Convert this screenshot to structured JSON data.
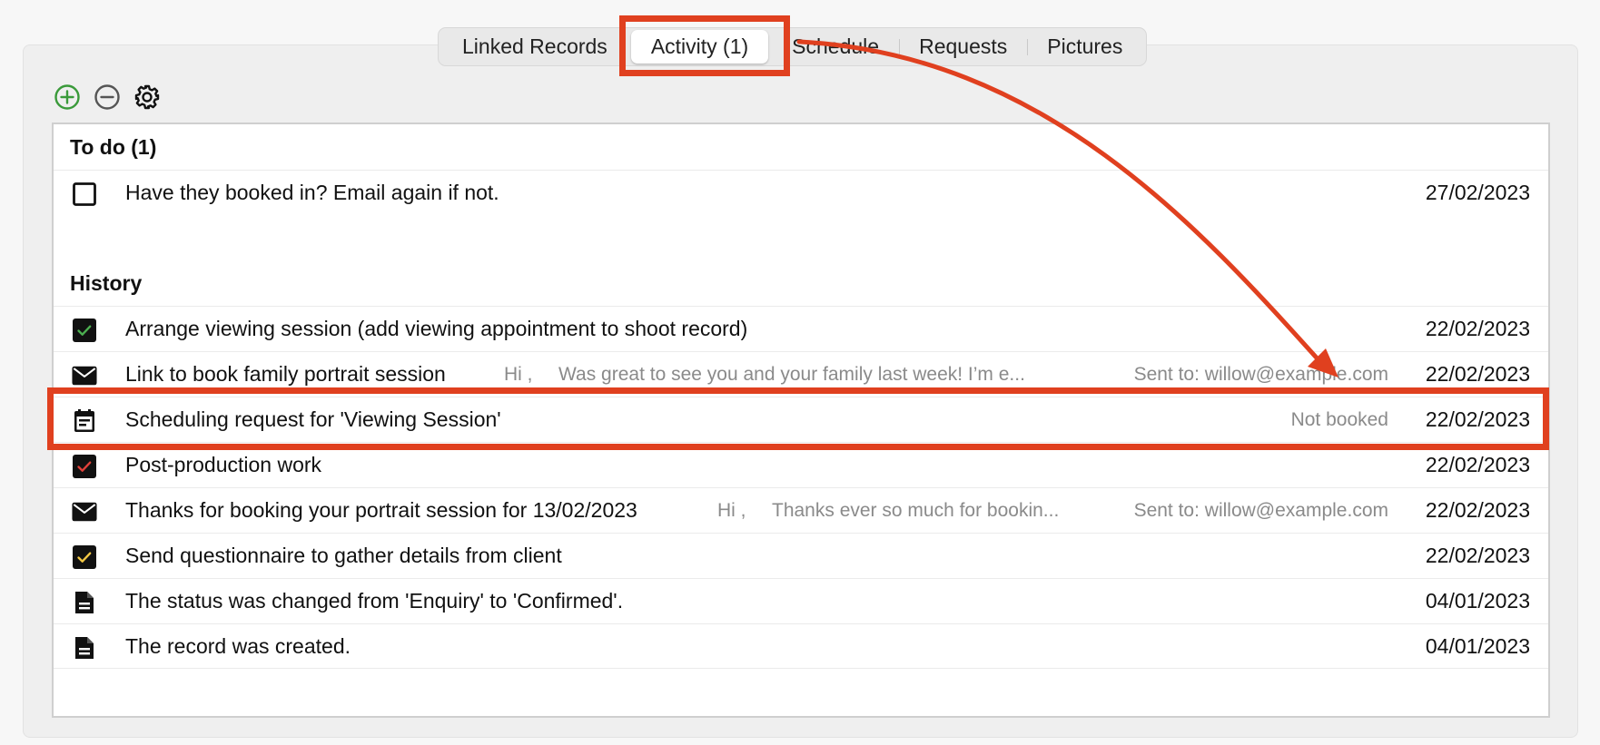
{
  "tabs": [
    {
      "label": "Linked Records",
      "active": false
    },
    {
      "label": "Activity (1)",
      "active": true
    },
    {
      "label": "Schedule",
      "active": false
    },
    {
      "label": "Requests",
      "active": false
    },
    {
      "label": "Pictures",
      "active": false
    }
  ],
  "toolbar": {
    "add_icon": "plus-circle-icon",
    "remove_icon": "minus-circle-icon",
    "settings_icon": "gear-icon"
  },
  "sections": {
    "todo": {
      "header": "To do (1)",
      "rows": [
        {
          "icon": "checkbox-empty-icon",
          "title": "Have they booked in? Email again if not.",
          "date": "27/02/2023"
        }
      ]
    },
    "history": {
      "header": "History",
      "rows": [
        {
          "icon": "checkbox-checked-green-icon",
          "title": "Arrange viewing session (add viewing appointment to shoot record)",
          "date": "22/02/2023"
        },
        {
          "icon": "envelope-icon",
          "title": "Link to book family portrait session",
          "preview_greeting": "Hi ,",
          "preview_text": "Was great to see you and your family last week!   I’m e...",
          "sent_to": "Sent to: willow@example.com",
          "date": "22/02/2023"
        },
        {
          "icon": "calendar-request-icon",
          "title": "Scheduling request for 'Viewing Session'",
          "status": "Not booked",
          "date": "22/02/2023"
        },
        {
          "icon": "checkbox-checked-red-icon",
          "title": "Post-production work",
          "date": "22/02/2023"
        },
        {
          "icon": "envelope-icon",
          "title": "Thanks for booking your portrait session for 13/02/2023",
          "preview_greeting": "Hi ,",
          "preview_text": "Thanks ever so much for bookin...",
          "sent_to": "Sent to: willow@example.com",
          "date": "22/02/2023"
        },
        {
          "icon": "checkbox-checked-yellow-icon",
          "title": "Send questionnaire to gather details from client",
          "date": "22/02/2023"
        },
        {
          "icon": "document-icon",
          "title": "The status was changed from 'Enquiry' to 'Confirmed'.",
          "date": "04/01/2023"
        },
        {
          "icon": "document-icon",
          "title": "The record was created.",
          "date": "04/01/2023"
        }
      ]
    }
  },
  "colors": {
    "annotation": "#e0401f",
    "add_green": "#3a9a3a",
    "check_green": "#4caf50",
    "check_red": "#e0413a",
    "check_yellow": "#f2c744"
  }
}
